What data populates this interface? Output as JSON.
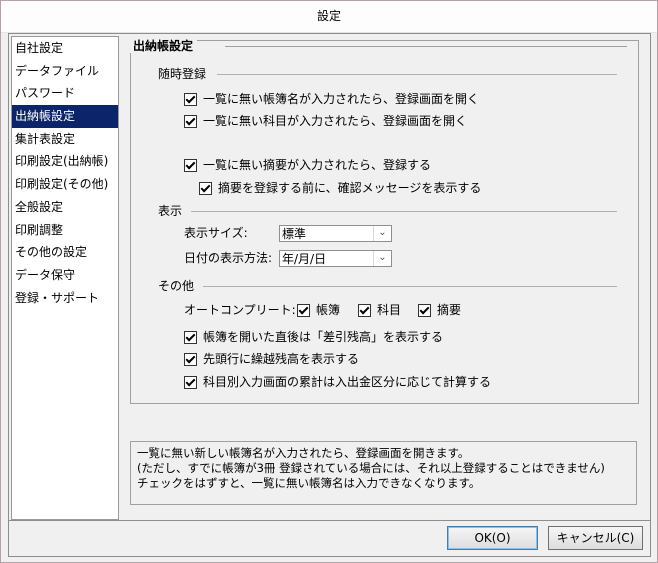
{
  "window": {
    "title": "設定"
  },
  "sidebar": {
    "items": [
      {
        "label": "自社設定",
        "selected": false
      },
      {
        "label": "データファイル",
        "selected": false
      },
      {
        "label": "パスワード",
        "selected": false
      },
      {
        "label": "出納帳設定",
        "selected": true
      },
      {
        "label": "集計表設定",
        "selected": false
      },
      {
        "label": "印刷設定(出納帳)",
        "selected": false
      },
      {
        "label": "印刷設定(その他)",
        "selected": false
      },
      {
        "label": "全般設定",
        "selected": false
      },
      {
        "label": "印刷調整",
        "selected": false
      },
      {
        "label": "その他の設定",
        "selected": false
      },
      {
        "label": "データ保守",
        "selected": false
      },
      {
        "label": "登録・サポート",
        "selected": false
      }
    ]
  },
  "panel": {
    "title": "出納帳設定",
    "sections": {
      "auto_register": {
        "label": "随時登録",
        "opt1": {
          "label": "一覧に無い帳簿名が入力されたら、登録画面を開く",
          "checked": true
        },
        "opt2": {
          "label": "一覧に無い科目が入力されたら、登録画面を開く",
          "checked": true
        },
        "opt3": {
          "label": "一覧に無い摘要が入力されたら、登録する",
          "checked": true
        },
        "opt4": {
          "label": "摘要を登録する前に、確認メッセージを表示する",
          "checked": true
        }
      },
      "display": {
        "label": "表示",
        "size_label": "表示サイズ:",
        "size_value": "標準",
        "date_label": "日付の表示方法:",
        "date_value": "年/月/日"
      },
      "other": {
        "label": "その他",
        "autocomplete_label": "オートコンプリート:",
        "ac_book": {
          "label": "帳簿",
          "checked": true
        },
        "ac_account": {
          "label": "科目",
          "checked": true
        },
        "ac_summary": {
          "label": "摘要",
          "checked": true
        },
        "opt5": {
          "label": "帳簿を開いた直後は「差引残高」を表示する",
          "checked": true
        },
        "opt6": {
          "label": "先頭行に繰越残高を表示する",
          "checked": true
        },
        "opt7": {
          "label": "科目別入力画面の累計は入出金区分に応じて計算する",
          "checked": true
        }
      }
    }
  },
  "description": {
    "line1": "一覧に無い新しい帳簿名が入力されたら、登録画面を開きます。",
    "line2": "(ただし、すでに帳簿が3冊 登録されている場合には、それ以上登録することはできません)",
    "line3": "チェックをはずすと、一覧に無い帳簿名は入力できなくなります。"
  },
  "buttons": {
    "ok": "OK(O)",
    "cancel": "キャンセル(C)"
  }
}
